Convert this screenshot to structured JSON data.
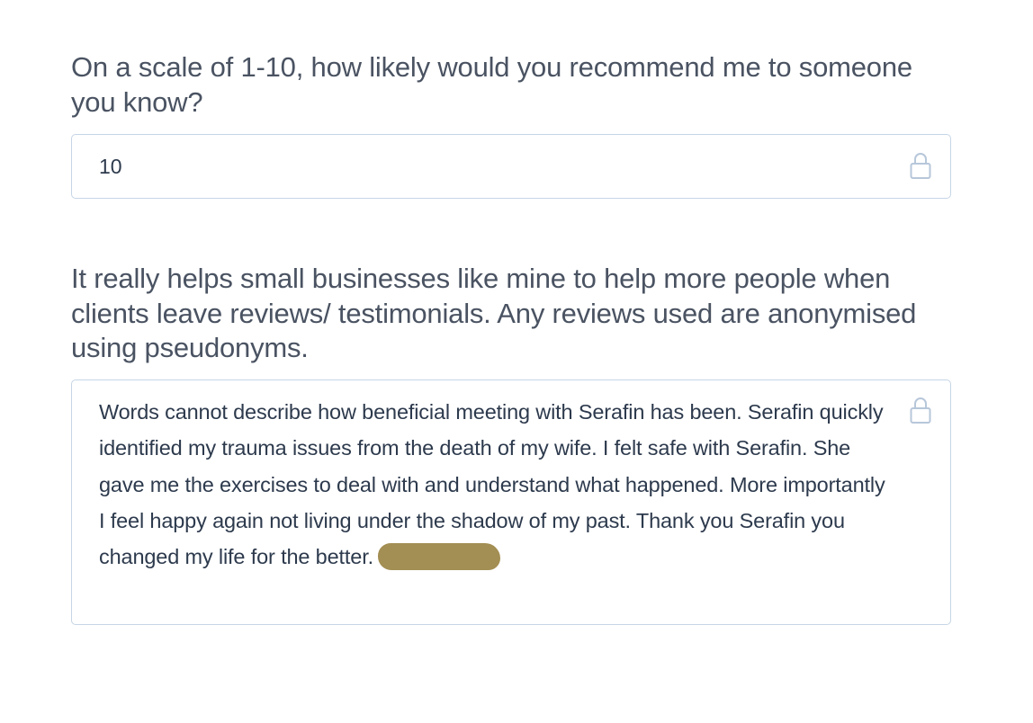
{
  "form": {
    "questions": [
      {
        "label": "On a scale of 1-10, how likely would you recommend me to someone you know?",
        "answer": "10",
        "locked": true,
        "lock_icon": "lock-icon"
      },
      {
        "label": "It really helps small businesses like mine to help more people when clients leave reviews/ testimonials. Any reviews used are anonymised using pseudonyms.",
        "answer": "Words cannot describe how beneficial meeting with Serafin has been. Serafin quickly identified my trauma issues from the death of my wife. I felt safe with Serafin. She gave me the exercises to deal with and understand what happened. More importantly I feel happy again not living under the shadow of my past. Thank you Serafin you changed my life for the better.",
        "locked": true,
        "lock_icon": "lock-icon",
        "redaction_color": "#a38e53"
      }
    ]
  },
  "colors": {
    "question_text": "#4a5362",
    "answer_text": "#2d3a4d",
    "field_border": "#c6d5e6",
    "lock_icon": "#b7c7da"
  }
}
